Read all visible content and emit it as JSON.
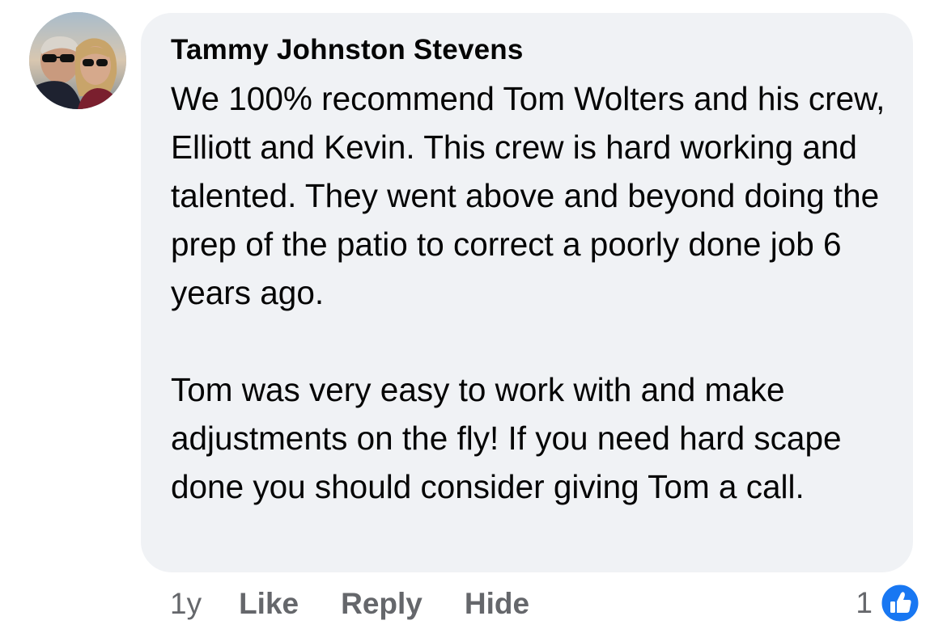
{
  "comment": {
    "author": "Tammy Johnston Stevens",
    "paragraphs": [
      "We 100% recommend Tom Wolters and his crew, Elliott and Kevin. This crew is hard working and talented. They went above and beyond doing the prep of the patio to correct a poorly done job 6 years ago.",
      "Tom was very easy to work with and make adjustments on the fly! If you need hard scape done you should consider giving Tom a call."
    ],
    "bubble_color": "#f0f2f5"
  },
  "actions": {
    "time": "1y",
    "like_label": "Like",
    "reply_label": "Reply",
    "hide_label": "Hide"
  },
  "reactions": {
    "count": "1",
    "icon": "like-thumbs-up-icon",
    "icon_color": "#1877f2"
  }
}
